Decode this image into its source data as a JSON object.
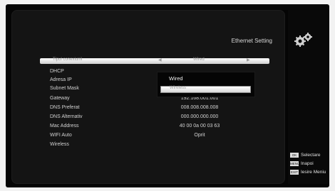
{
  "header": {
    "title": "Ethernet Setting"
  },
  "selected_row": {
    "label": "Tipul conexiunii",
    "value": "Wired"
  },
  "dropdown": {
    "options": [
      "Wired",
      "Wireless"
    ]
  },
  "settings": [
    {
      "label": "DHCP",
      "value": ""
    },
    {
      "label": "Adresa IP",
      "value": ""
    },
    {
      "label": "Subnet Mask",
      "value": ""
    },
    {
      "label": "Gateway",
      "value": "192.168.001.001"
    },
    {
      "label": "DNS Preferat",
      "value": "008.008.008.008"
    },
    {
      "label": "DNS Alternativ",
      "value": "000.000.000.000"
    },
    {
      "label": "Mac Address",
      "value": "40 00 0a 00 03 63"
    },
    {
      "label": "WIFI Auto",
      "value": "Oprit"
    },
    {
      "label": "Wireless",
      "value": ""
    }
  ],
  "legend": [
    {
      "key": "OK",
      "label": "Selectare"
    },
    {
      "key": "MENU",
      "label": "Inapoi"
    },
    {
      "key": "EXIT",
      "label": "Iesire Meniu"
    }
  ]
}
